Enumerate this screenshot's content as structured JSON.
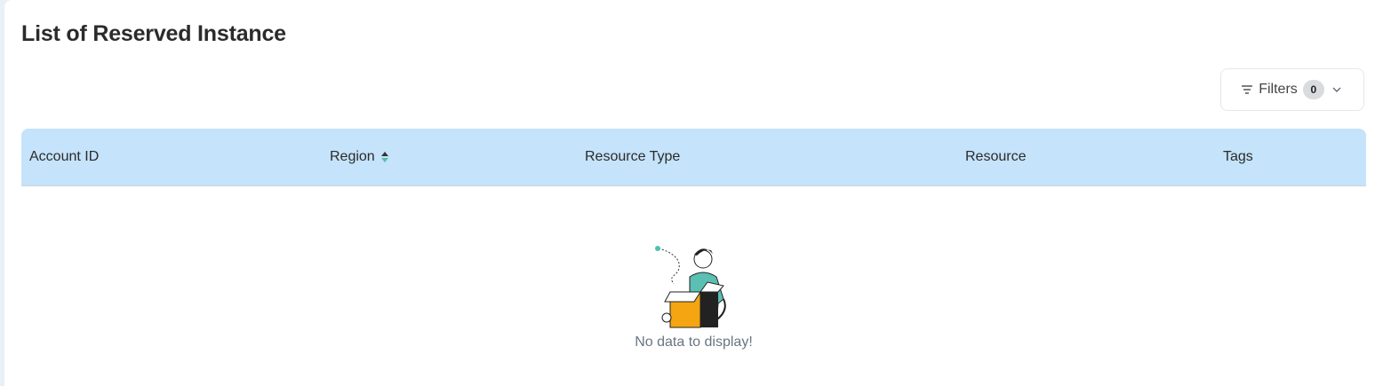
{
  "page": {
    "title": "List of Reserved Instance"
  },
  "filters": {
    "label": "Filters",
    "count": "0"
  },
  "table": {
    "columns": [
      {
        "label": "Account ID"
      },
      {
        "label": "Region",
        "sortable": true
      },
      {
        "label": "Resource Type"
      },
      {
        "label": "Resource"
      },
      {
        "label": "Tags"
      }
    ],
    "rows": [],
    "empty_message": "No data to display!"
  },
  "colors": {
    "header_bg": "#c5e3fa",
    "accent": "#4fc1b0",
    "box": "#f5a511"
  }
}
